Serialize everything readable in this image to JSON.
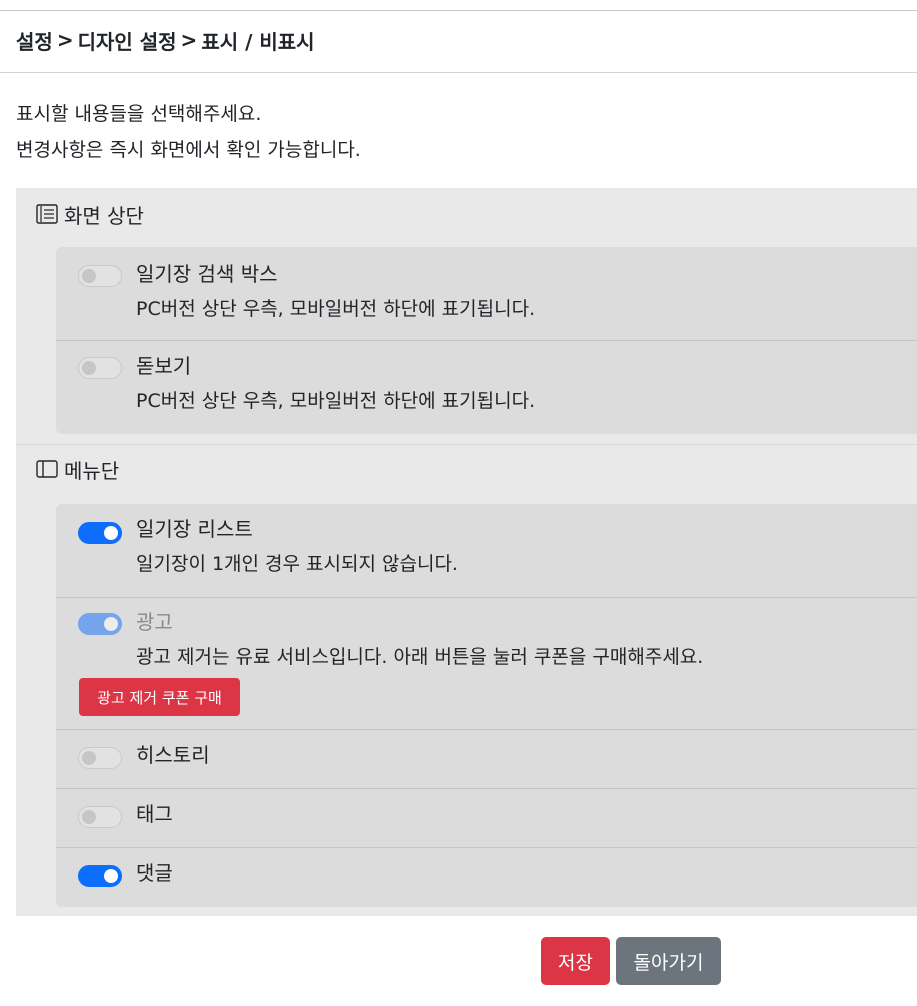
{
  "breadcrumb": {
    "items": [
      "설정",
      "디자인 설정",
      "표시 / 비표시"
    ],
    "separator": ">"
  },
  "intro": {
    "line1": "표시할 내용들을 선택해주세요.",
    "line2": "변경사항은 즉시 화면에서 확인 가능합니다."
  },
  "sections": [
    {
      "title": "화면 상단",
      "icon": "list-icon",
      "items": [
        {
          "label": "일기장 검색 박스",
          "description": "PC버전 상단 우측, 모바일버전 하단에 표기됩니다.",
          "enabled": false
        },
        {
          "label": "돋보기",
          "description": "PC버전 상단 우측, 모바일버전 하단에 표기됩니다.",
          "enabled": false
        }
      ]
    },
    {
      "title": "메뉴단",
      "icon": "sidebar-icon",
      "items": [
        {
          "label": "일기장 리스트",
          "description": "일기장이 1개인 경우 표시되지 않습니다.",
          "enabled": true
        },
        {
          "label": "광고",
          "description": "광고 제거는 유료 서비스입니다. 아래 버튼을 눌러 쿠폰을 구매해주세요.",
          "enabled": true,
          "disabled": true,
          "button": "광고 제거 쿠폰 구매"
        },
        {
          "label": "히스토리",
          "enabled": false
        },
        {
          "label": "태그",
          "enabled": false
        },
        {
          "label": "댓글",
          "enabled": true
        }
      ]
    }
  ],
  "footer": {
    "save_label": "저장",
    "back_label": "돌아가기"
  },
  "colors": {
    "toggle_on": "#0d6efd",
    "danger": "#dc3545",
    "secondary": "#6c757d"
  }
}
